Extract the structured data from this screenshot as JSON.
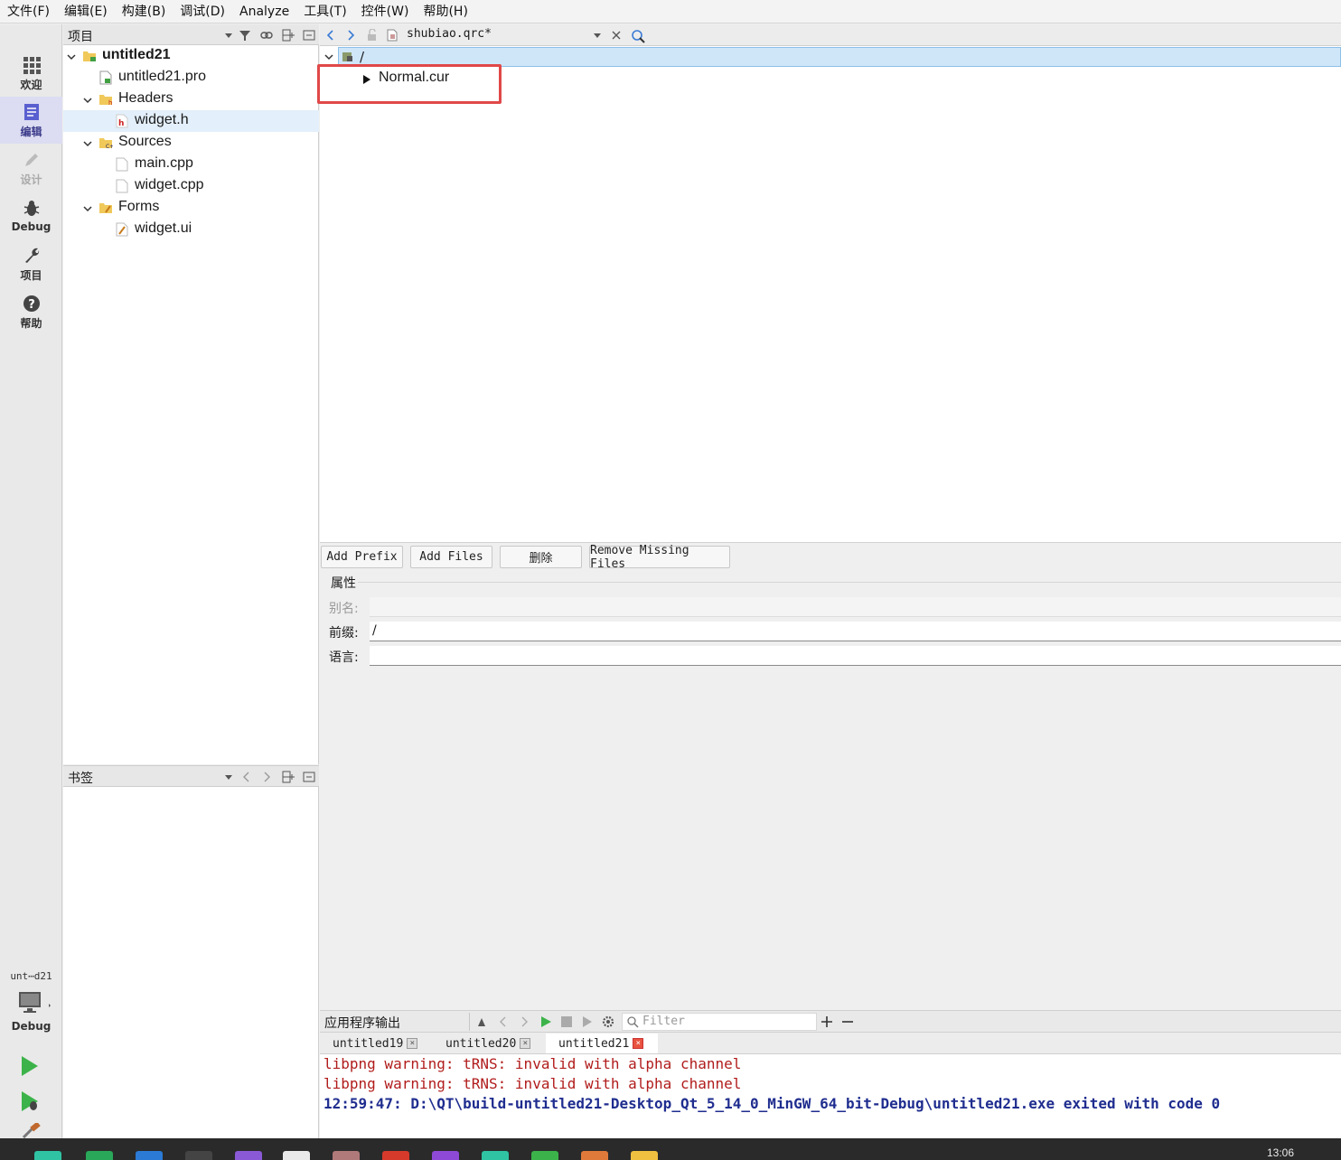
{
  "menu": [
    "文件(F)",
    "编辑(E)",
    "构建(B)",
    "调试(D)",
    "Analyze",
    "工具(T)",
    "控件(W)",
    "帮助(H)"
  ],
  "modes": [
    {
      "label": "欢迎",
      "icon": "grid-icon"
    },
    {
      "label": "编辑",
      "icon": "edit-document-icon"
    },
    {
      "label": "设计",
      "icon": "pencil-icon"
    },
    {
      "label": "Debug",
      "icon": "bug-icon"
    },
    {
      "label": "项目",
      "icon": "wrench-icon"
    },
    {
      "label": "帮助",
      "icon": "help-icon"
    }
  ],
  "project_panel": {
    "title": "项目",
    "tree": [
      {
        "label": "untitled21"
      },
      {
        "label": "untitled21.pro"
      },
      {
        "label": "Headers"
      },
      {
        "label": "widget.h"
      },
      {
        "label": "Sources"
      },
      {
        "label": "main.cpp"
      },
      {
        "label": "widget.cpp"
      },
      {
        "label": "Forms"
      },
      {
        "label": "widget.ui"
      }
    ]
  },
  "bookmarks_panel": {
    "title": "书签"
  },
  "editor": {
    "file_name": "shubiao.qrc*",
    "prefix": "/",
    "file_entry": "Normal.cur"
  },
  "buttons": {
    "add_prefix": "Add Prefix",
    "add_files": "Add Files",
    "delete": "删除",
    "remove_missing": "Remove Missing Files"
  },
  "properties": {
    "title": "属性",
    "alias_label": "别名:",
    "alias_value": "",
    "prefix_label": "前缀:",
    "prefix_value": "/",
    "language_label": "语言:",
    "language_value": ""
  },
  "output": {
    "title": "应用程序输出",
    "filter_placeholder": "Filter",
    "tabs": [
      "untitled19",
      "untitled20",
      "untitled21"
    ],
    "lines": [
      "libpng warning: tRNS: invalid with alpha channel",
      "libpng warning: tRNS: invalid with alpha channel",
      "12:59:47: D:\\QT\\build-untitled21-Desktop_Qt_5_14_0_MinGW_64_bit-Debug\\untitled21.exe exited with code 0"
    ]
  },
  "kit": {
    "project": "unt⋯d21",
    "mode": "Debug"
  },
  "clock": "13:06",
  "colors": {
    "highlight_box": "#e04848",
    "warning_text": "#b11c1c",
    "info_text": "#1f2d8f"
  }
}
